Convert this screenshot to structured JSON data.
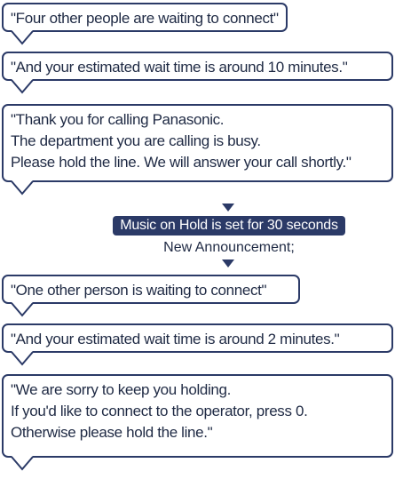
{
  "messages_before": [
    {
      "lines": [
        "\"Four other people are waiting to connect\""
      ]
    },
    {
      "lines": [
        "\"And your estimated wait time is around 10 minutes.\""
      ]
    },
    {
      "lines": [
        "\"Thank you for calling Panasonic.",
        "The department you are calling is busy.",
        "Please hold the line. We will answer your call shortly.\""
      ]
    }
  ],
  "music_on_hold_label": "Music on Hold is set for 30 seconds",
  "new_announcement_label": "New Announcement;",
  "messages_after": [
    {
      "lines": [
        "\"One other person is waiting to connect\""
      ]
    },
    {
      "lines": [
        "\"And your estimated wait time is around 2 minutes.\""
      ]
    },
    {
      "lines": [
        "\"We are sorry to keep you holding.",
        "If you'd like to connect to the operator, press 0.",
        "Otherwise please hold the line.\""
      ]
    }
  ],
  "colors": {
    "border": "#2b3a67",
    "text": "#1f2a44",
    "banner_bg": "#2b3a67",
    "banner_text": "#ffffff"
  }
}
